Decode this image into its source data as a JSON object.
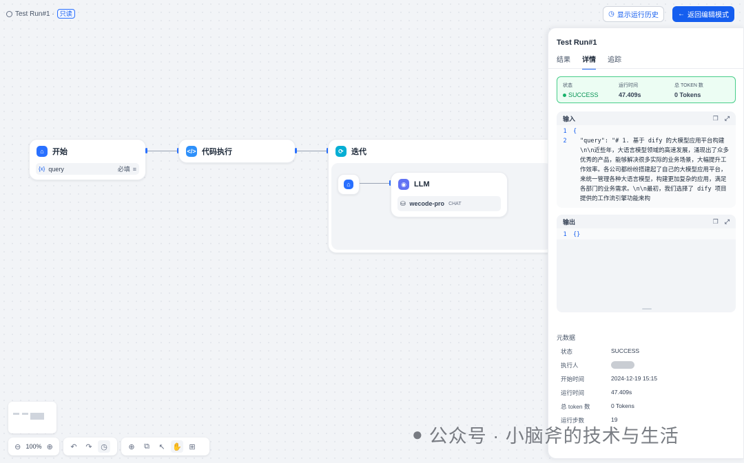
{
  "header": {
    "run_title": "Test Run#1 ·",
    "read_only_badge": "只读",
    "history_button": "显示运行历史",
    "back_button": "返回编辑模式"
  },
  "nodes": {
    "start": {
      "title": "开始",
      "var_icon": "{x}",
      "var_name": "query",
      "var_required": "必填"
    },
    "code": {
      "title": "代码执行"
    },
    "iteration": {
      "title": "迭代"
    },
    "llm": {
      "title": "LLM",
      "model": "wecode-pro",
      "model_tag": "CHAT"
    }
  },
  "panel": {
    "title": "Test Run#1",
    "tabs": [
      "结果",
      "详情",
      "追踪"
    ],
    "active_tab": 1,
    "status": {
      "status_label": "状态",
      "status_value": "SUCCESS",
      "time_label": "运行时间",
      "time_value": "47.409s",
      "token_label": "总 TOKEN 数",
      "token_value": "0 Tokens"
    },
    "input": {
      "label": "输入",
      "line_numbers": [
        "1",
        "2"
      ],
      "lines": [
        "{",
        "\"query\": \"# 1. 基于 dify 的大模型应用平台构建\\n\\n近些年，大语言模型领域的高速发展，涌现出了众多优秀的产品，能够解决很多实际的业务场景，大幅提升工作效率。各公司都纷纷搭建起了自己的大模型应用平台，来统一管理各种大语言模型，构建更加复杂的应用，满足各部门的业务需求。\\n\\n最初，我们选择了 dify 项目提供的工作流引擎功能来构"
      ]
    },
    "output": {
      "label": "输出",
      "line_numbers": [
        "1"
      ],
      "lines": [
        "{}"
      ]
    },
    "metadata": {
      "title": "元数据",
      "rows": [
        {
          "label": "状态",
          "value": "SUCCESS"
        },
        {
          "label": "执行人",
          "value": ""
        },
        {
          "label": "开始时间",
          "value": "2024-12-19 15:15"
        },
        {
          "label": "运行时间",
          "value": "47.409s"
        },
        {
          "label": "总 token 数",
          "value": "0 Tokens"
        },
        {
          "label": "运行步数",
          "value": "19"
        }
      ]
    }
  },
  "controls": {
    "zoom": "100%"
  },
  "watermark": "公众号 · 小脑斧的技术与生活",
  "colors": {
    "accent": "#155eef",
    "success": "#17b26a",
    "success_bg": "#ecfdf3"
  }
}
